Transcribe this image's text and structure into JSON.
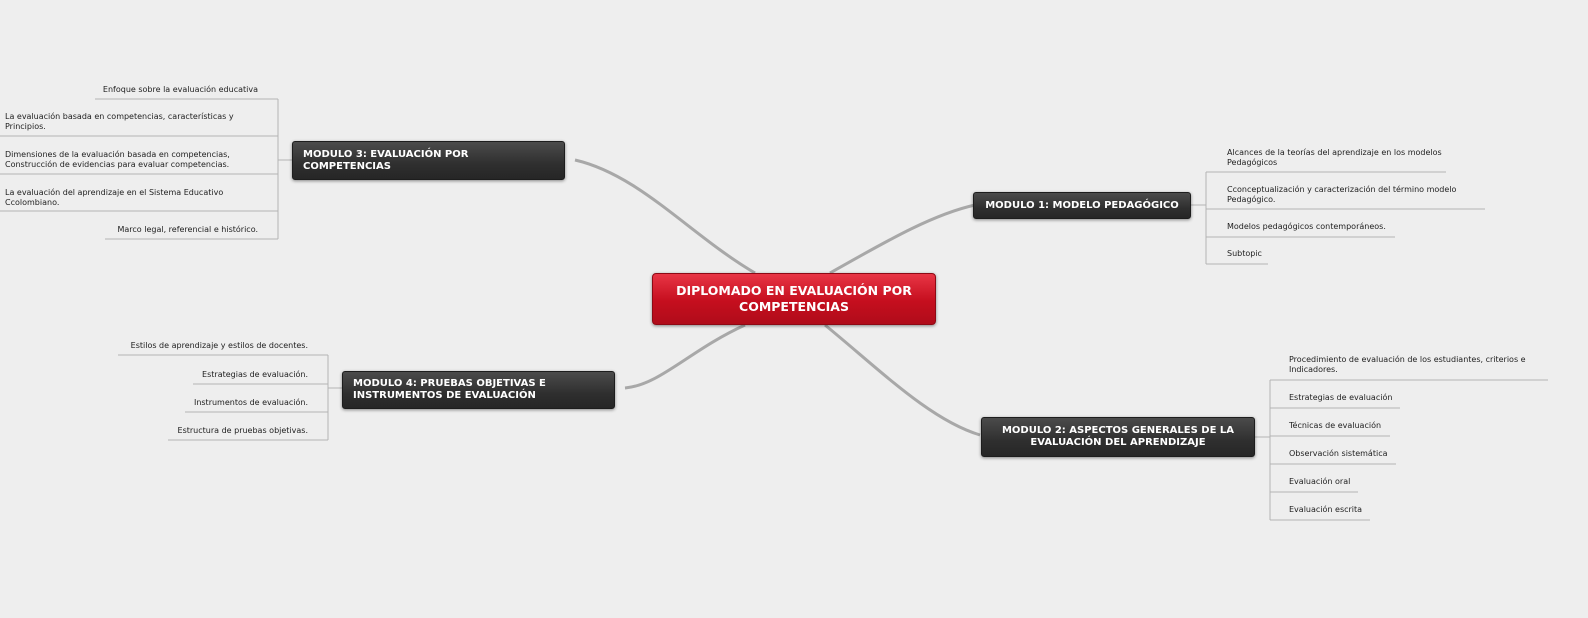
{
  "central_topic": "DIPLOMADO EN EVALUACIÓN POR COMPETENCIAS",
  "colors": {
    "background": "#eeeeee",
    "central": "#c50e1e",
    "module": "#2f2f2f",
    "connector": "#a8a8a8"
  },
  "modules": {
    "m1": {
      "title": "MODULO 1: MODELO PEDAGÓGICO",
      "topics": [
        "Alcances de la teorías del aprendizaje en los modelos Pedagógicos",
        "Cconceptualización y caracterización del término modelo Pedagógico.",
        "Modelos pedagógicos contemporáneos.",
        "Subtopic"
      ]
    },
    "m2": {
      "title": "MODULO 2: ASPECTOS GENERALES DE LA EVALUACIÓN DEL APRENDIZAJE",
      "topics": [
        "Procedimiento de evaluación de los estudiantes, criterios e Indicadores.",
        "Estrategias de evaluación",
        "Técnicas de evaluación",
        "Observación sistemática",
        "Evaluación oral",
        "Evaluación escrita"
      ]
    },
    "m3": {
      "title": "MODULO 3: EVALUACIÓN POR COMPETENCIAS",
      "topics": [
        "Enfoque sobre la evaluación educativa",
        "La evaluación basada en competencias, características y Principios.",
        "Dimensiones de la evaluación basada en competencias, Construcción de evidencias para evaluar competencias.",
        "La evaluación del aprendizaje en el Sistema Educativo Ccolombiano.",
        "Marco legal, referencial e histórico."
      ]
    },
    "m4": {
      "title": "MODULO 4: PRUEBAS OBJETIVAS E INSTRUMENTOS DE EVALUACIÓN",
      "topics": [
        "Estilos de aprendizaje y estilos de docentes.",
        "Estrategias de evaluación.",
        "Instrumentos de evaluación.",
        "Estructura de pruebas objetivas."
      ]
    }
  }
}
